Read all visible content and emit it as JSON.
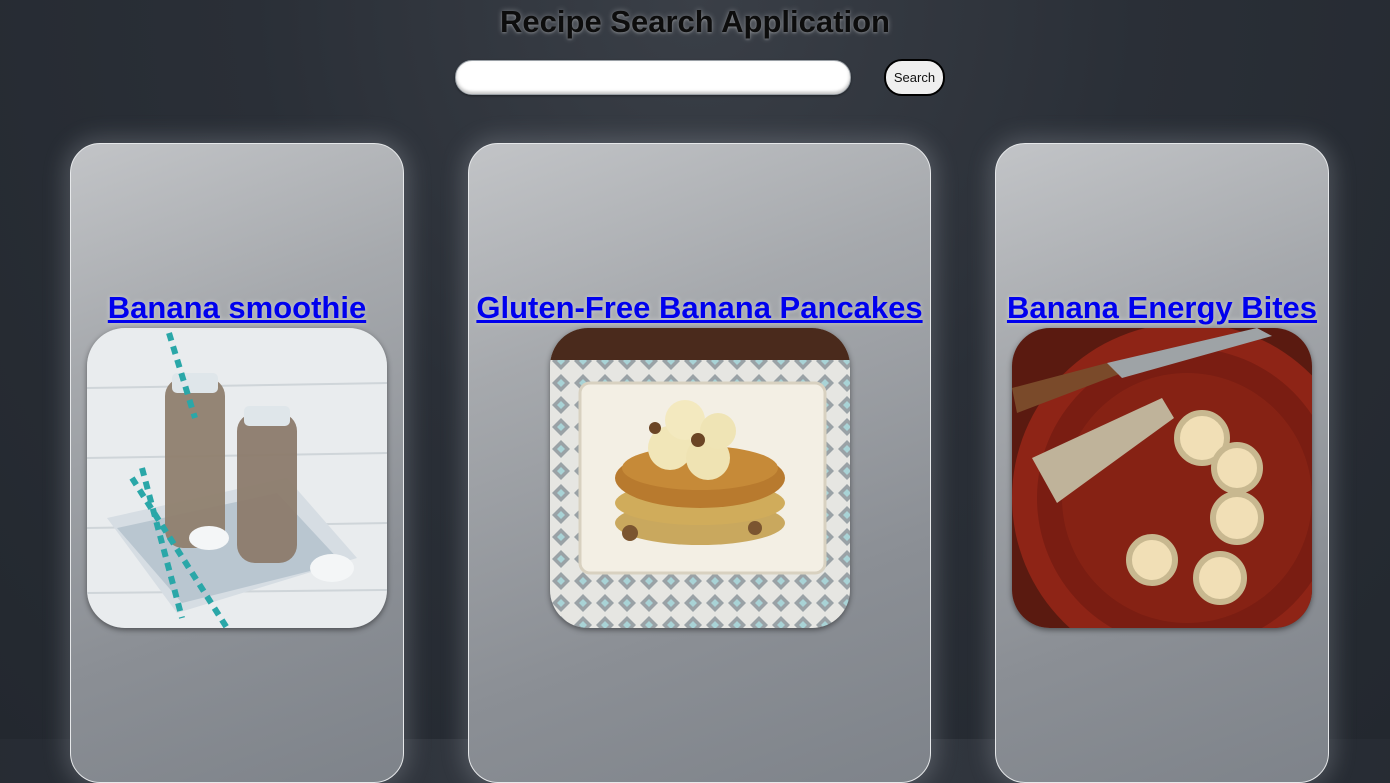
{
  "header": {
    "title": "Recipe Search Application"
  },
  "search": {
    "value": "",
    "placeholder": "",
    "button_label": "Search"
  },
  "recipes": [
    {
      "title": "Banana smoothie",
      "image": "banana-smoothie-photo"
    },
    {
      "title": "Gluten-Free Banana Pancakes",
      "image": "banana-pancakes-photo"
    },
    {
      "title": "Banana Energy Bites",
      "image": "banana-energy-bites-photo"
    }
  ]
}
